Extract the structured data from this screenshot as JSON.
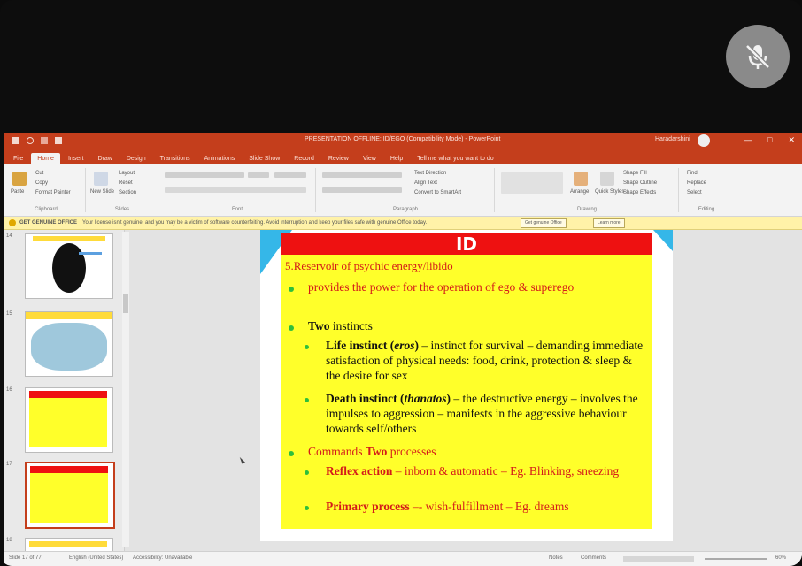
{
  "video_call": {
    "mic_icon": "mic-muted-icon"
  },
  "window": {
    "title": "PRESENTATION OFFLINE: ID/EGO (Compatibility Mode) - PowerPoint",
    "user": "Haradarshini",
    "controls": [
      "—",
      "□",
      "✕"
    ]
  },
  "ribbon": {
    "tabs": [
      "File",
      "Home",
      "Insert",
      "Draw",
      "Design",
      "Transitions",
      "Animations",
      "Slide Show",
      "Record",
      "Review",
      "View",
      "Help",
      "Tell me what you want to do"
    ],
    "active_tab": "Home",
    "groups": [
      "Clipboard",
      "Slides",
      "Font",
      "Paragraph",
      "Drawing",
      "Editing"
    ],
    "clipboard": {
      "paste": "Paste",
      "cut": "Cut",
      "copy": "Copy",
      "format_painter": "Format Painter"
    },
    "slides": {
      "new_slide": "New Slide",
      "layout": "Layout",
      "reset": "Reset",
      "section": "Section"
    },
    "paragraph": {
      "text_direction": "Text Direction",
      "align_text": "Align Text",
      "smartart": "Convert to SmartArt"
    },
    "drawing": {
      "arrange": "Arrange",
      "quick_styles": "Quick Styles",
      "shape_fill": "Shape Fill",
      "shape_outline": "Shape Outline",
      "shape_effects": "Shape Effects"
    },
    "editing": {
      "find": "Find",
      "replace": "Replace",
      "select": "Select"
    }
  },
  "message_bar": {
    "label": "GET GENUINE OFFICE",
    "text": "Your license isn't genuine, and you may be a victim of software counterfeiting. Avoid interruption and keep your files safe with genuine Office today.",
    "button1": "Get genuine Office",
    "button2": "Learn more"
  },
  "thumbnails": [
    {
      "number": "14"
    },
    {
      "number": "15"
    },
    {
      "number": "16"
    },
    {
      "number": "17"
    },
    {
      "number": "18"
    }
  ],
  "slide": {
    "title": "ID",
    "heading": "5.Reservoir of psychic energy/libido",
    "b1": "provides the power for the operation of ego & superego",
    "b2_bold": "Two",
    "b2_rest": "instincts",
    "s1_bold": "Life instinct (",
    "s1_italic": "eros",
    "s1_close": ")",
    "s1_rest": " – instinct for survival – demanding immediate satisfaction of physical needs: food, drink, protection & sleep & the desire for sex",
    "s2_bold": "Death instinct (",
    "s2_italic": "thanatos",
    "s2_close": ")",
    "s2_rest": " – the destructive energy – involves the impulses to aggression – manifests in the aggressive behaviour towards self/others",
    "b3_pre": "Commands",
    "b3_bold": "Two",
    "b3_post": "processes",
    "s3_bold": "Reflex action",
    "s3_rest": " – inborn & automatic  – Eg. Blinking, sneezing",
    "s4_bold": "Primary process",
    "s4_rest": " –- wish-fulfillment – Eg. dreams"
  },
  "status": {
    "slide_count": "Slide 17 of 77",
    "language": "English (United States)",
    "accessibility": "Accessibility: Unavailable",
    "notes": "Notes",
    "comments": "Comments",
    "zoom": "60%"
  },
  "colors": {
    "ppt_red": "#c43e1c",
    "slide_yellow": "#ffff2a",
    "slide_title_red": "#ee1111",
    "accent_blue": "#35b7e8",
    "bullet_green": "#2fbf3b"
  }
}
